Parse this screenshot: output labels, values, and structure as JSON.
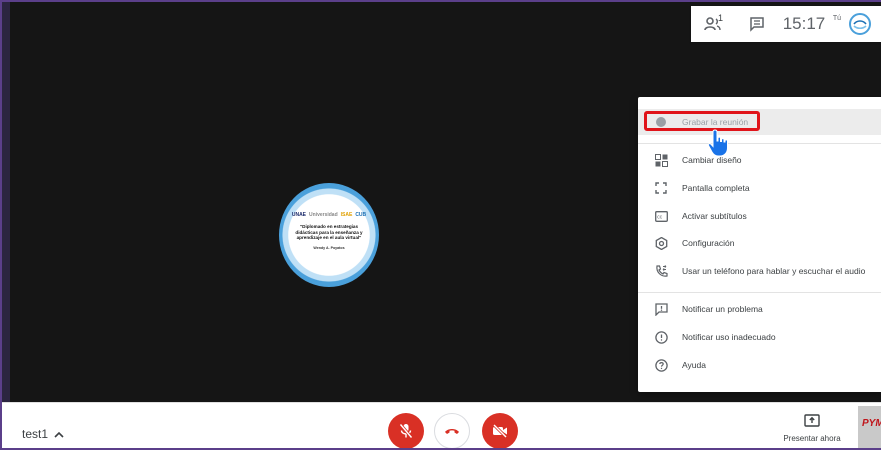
{
  "topbar": {
    "participants_count": "1",
    "time": "15:17",
    "me_label": "Tú"
  },
  "logo": {
    "org_1": "UNAE",
    "org_2": "Universidad",
    "org_3": "ISAE",
    "org_4": "CUB",
    "title": "\"Diplomado en estrategias didácticas para la enseñanza y aprendizaje en el aula virtual\"",
    "signature": "Wendy A. Poyatos"
  },
  "menu": {
    "items": [
      {
        "label": "Grabar la reunión",
        "icon": "record-icon"
      },
      {
        "label": "Cambiar diseño",
        "icon": "layout-icon"
      },
      {
        "label": "Pantalla completa",
        "icon": "fullscreen-icon"
      },
      {
        "label": "Activar subtítulos",
        "icon": "captions-icon"
      },
      {
        "label": "Configuración",
        "icon": "gear-icon"
      },
      {
        "label": "Usar un teléfono para hablar y escuchar el audio",
        "icon": "phone-icon"
      },
      {
        "label": "Notificar un problema",
        "icon": "feedback-icon"
      },
      {
        "label": "Notificar uso inadecuado",
        "icon": "info-icon"
      },
      {
        "label": "Ayuda",
        "icon": "help-icon"
      }
    ]
  },
  "bottombar": {
    "meeting_name": "test1",
    "present_label": "Presentar ahora",
    "brand": "PYM"
  },
  "colors": {
    "danger": "#d93025",
    "highlight": "#e0141a",
    "hand": "#1a73e8"
  }
}
